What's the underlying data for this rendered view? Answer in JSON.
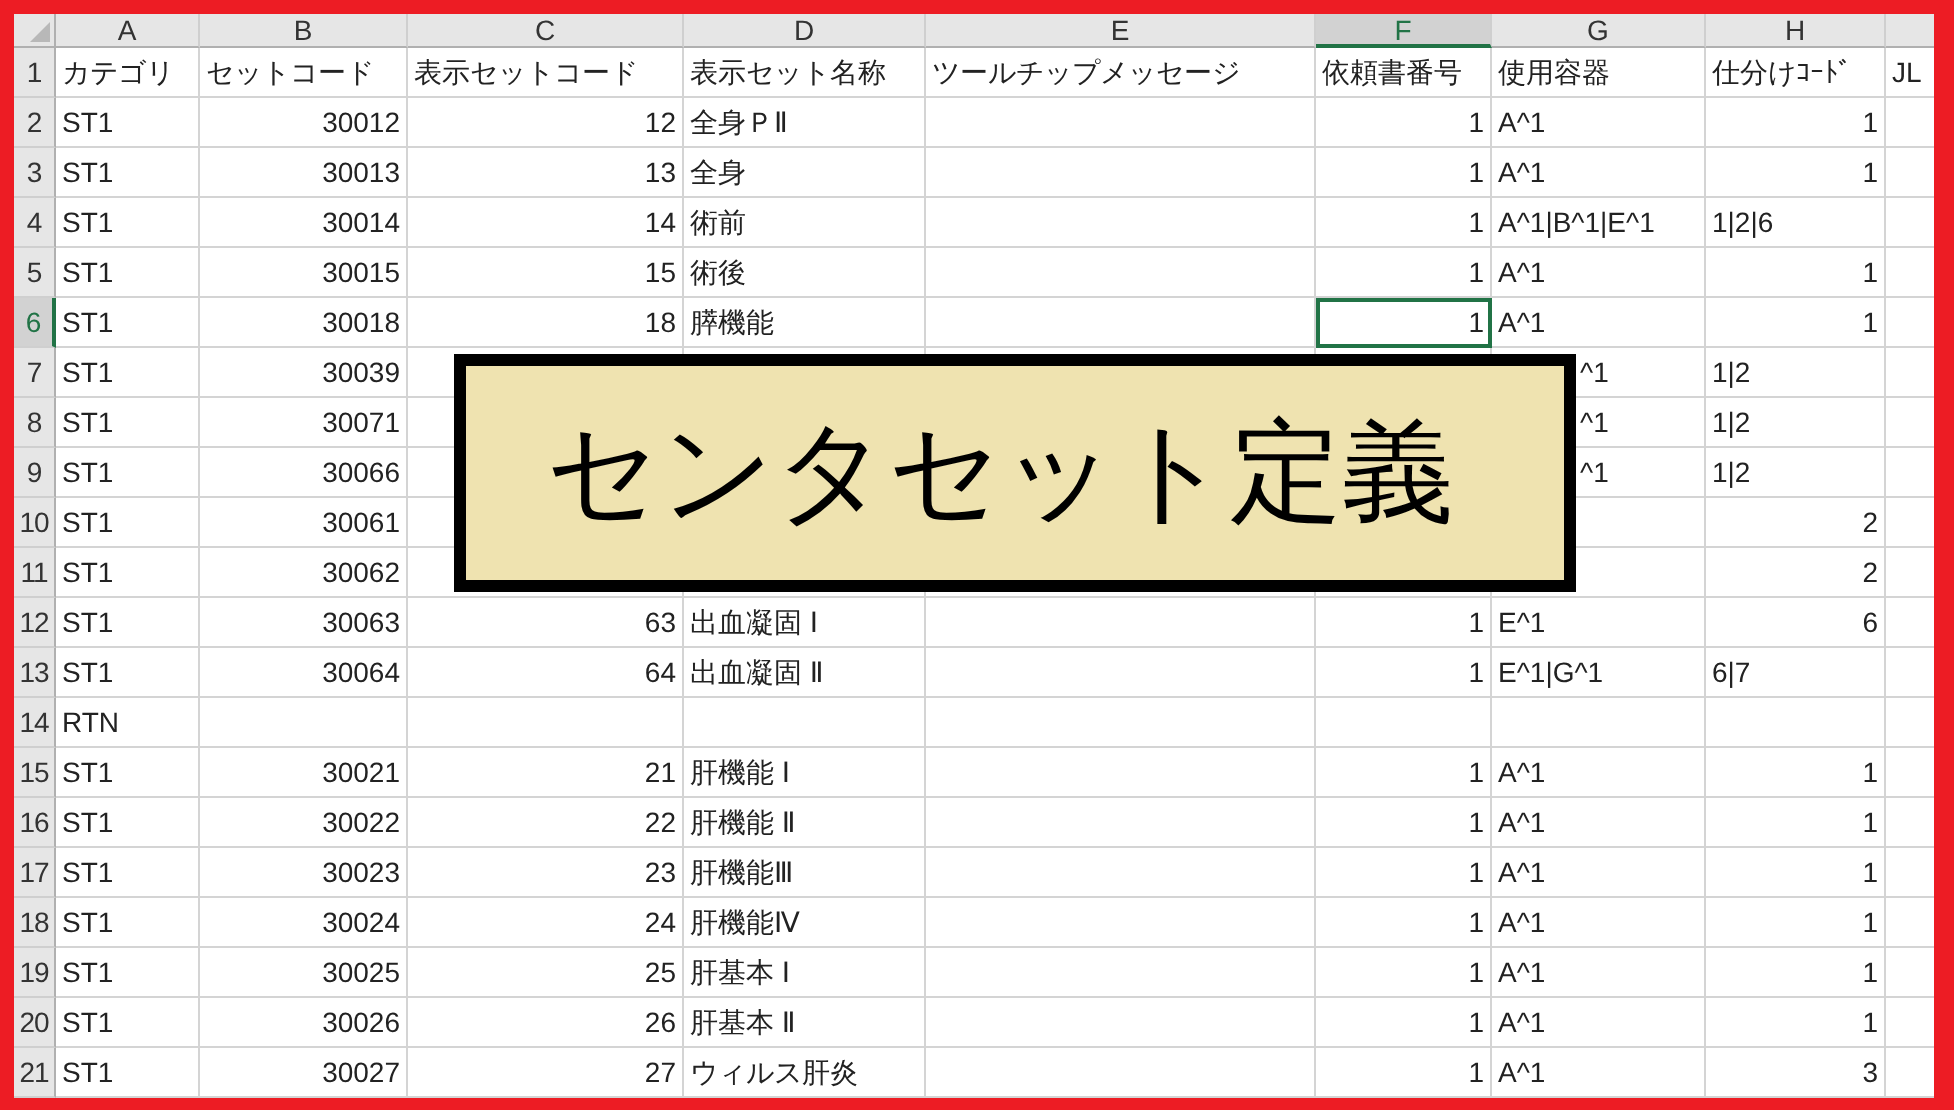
{
  "columns": [
    {
      "letter": "A",
      "selected": false
    },
    {
      "letter": "B",
      "selected": false
    },
    {
      "letter": "C",
      "selected": false
    },
    {
      "letter": "D",
      "selected": false
    },
    {
      "letter": "E",
      "selected": false
    },
    {
      "letter": "F",
      "selected": true
    },
    {
      "letter": "G",
      "selected": false
    },
    {
      "letter": "H",
      "selected": false
    },
    {
      "selected": false
    }
  ],
  "rows": [
    {
      "number": "1",
      "selected": false,
      "covered": false,
      "cells": [
        "カテゴリ",
        "セットコード",
        "表示セットコード",
        "表示セット名称",
        "ツールチップメッセージ",
        "依頼書番号",
        "使用容器",
        "仕分けｺｰﾄﾞ",
        "JL"
      ]
    },
    {
      "number": "2",
      "selected": false,
      "covered": false,
      "cells": [
        "ST1",
        {
          "number": "30012"
        },
        {
          "number": "12"
        },
        "全身ＰⅡ",
        null,
        {
          "number": "1"
        },
        "A^1",
        {
          "number": "1"
        }
      ]
    },
    {
      "number": "3",
      "selected": false,
      "covered": false,
      "cells": [
        "ST1",
        {
          "number": "30013"
        },
        {
          "number": "13"
        },
        "全身",
        null,
        {
          "number": "1"
        },
        "A^1",
        {
          "number": "1"
        }
      ]
    },
    {
      "number": "4",
      "selected": false,
      "covered": false,
      "cells": [
        "ST1",
        {
          "number": "30014"
        },
        {
          "number": "14"
        },
        "術前",
        null,
        {
          "number": "1"
        },
        "A^1|B^1|E^1",
        "1|2|6"
      ]
    },
    {
      "number": "5",
      "selected": false,
      "covered": false,
      "cells": [
        "ST1",
        {
          "number": "30015"
        },
        {
          "number": "15"
        },
        "術後",
        null,
        {
          "number": "1"
        },
        "A^1",
        {
          "number": "1"
        }
      ]
    },
    {
      "number": "6",
      "selected": true,
      "covered": false,
      "cells": [
        "ST1",
        {
          "number": "30018"
        },
        {
          "number": "18"
        },
        "膵機能",
        null,
        {
          "number": "1"
        },
        "A^1",
        {
          "number": "1"
        }
      ]
    },
    {
      "number": "7",
      "selected": false,
      "covered": true,
      "cells": [
        "ST1",
        {
          "number": "30039"
        },
        null,
        null,
        null,
        null,
        "^1",
        "1|2"
      ]
    },
    {
      "number": "8",
      "selected": false,
      "covered": true,
      "cells": [
        "ST1",
        {
          "number": "30071"
        },
        null,
        null,
        null,
        null,
        "^1",
        "1|2"
      ]
    },
    {
      "number": "9",
      "selected": false,
      "covered": true,
      "cells": [
        "ST1",
        {
          "number": "30066"
        },
        null,
        null,
        null,
        null,
        "^1",
        "1|2"
      ]
    },
    {
      "number": "10",
      "selected": false,
      "covered": true,
      "cells": [
        "ST1",
        {
          "number": "30061"
        },
        null,
        null,
        null,
        null,
        null,
        {
          "number": "2"
        }
      ]
    },
    {
      "number": "11",
      "selected": false,
      "covered": true,
      "cells": [
        "ST1",
        {
          "number": "30062"
        },
        null,
        null,
        null,
        null,
        null,
        {
          "number": "2"
        }
      ]
    },
    {
      "number": "12",
      "selected": false,
      "covered": false,
      "cells": [
        "ST1",
        {
          "number": "30063"
        },
        {
          "number": "63"
        },
        "出血凝固 Ⅰ",
        null,
        {
          "number": "1"
        },
        "E^1",
        {
          "number": "6"
        }
      ]
    },
    {
      "number": "13",
      "selected": false,
      "covered": false,
      "cells": [
        "ST1",
        {
          "number": "30064"
        },
        {
          "number": "64"
        },
        "出血凝固 Ⅱ",
        null,
        {
          "number": "1"
        },
        "E^1|G^1",
        "6|7"
      ]
    },
    {
      "number": "14",
      "selected": false,
      "covered": false,
      "cells": [
        "RTN"
      ]
    },
    {
      "number": "15",
      "selected": false,
      "covered": false,
      "cells": [
        "ST1",
        {
          "number": "30021"
        },
        {
          "number": "21"
        },
        "肝機能 Ⅰ",
        null,
        {
          "number": "1"
        },
        "A^1",
        {
          "number": "1"
        }
      ]
    },
    {
      "number": "16",
      "selected": false,
      "covered": false,
      "cells": [
        "ST1",
        {
          "number": "30022"
        },
        {
          "number": "22"
        },
        "肝機能 Ⅱ",
        null,
        {
          "number": "1"
        },
        "A^1",
        {
          "number": "1"
        }
      ]
    },
    {
      "number": "17",
      "selected": false,
      "covered": false,
      "cells": [
        "ST1",
        {
          "number": "30023"
        },
        {
          "number": "23"
        },
        "肝機能Ⅲ",
        null,
        {
          "number": "1"
        },
        "A^1",
        {
          "number": "1"
        }
      ]
    },
    {
      "number": "18",
      "selected": false,
      "covered": false,
      "cells": [
        "ST1",
        {
          "number": "30024"
        },
        {
          "number": "24"
        },
        "肝機能Ⅳ",
        null,
        {
          "number": "1"
        },
        "A^1",
        {
          "number": "1"
        }
      ]
    },
    {
      "number": "19",
      "selected": false,
      "covered": false,
      "cells": [
        "ST1",
        {
          "number": "30025"
        },
        {
          "number": "25"
        },
        "肝基本 Ⅰ",
        null,
        {
          "number": "1"
        },
        "A^1",
        {
          "number": "1"
        }
      ]
    },
    {
      "number": "20",
      "selected": false,
      "covered": false,
      "cells": [
        "ST1",
        {
          "number": "30026"
        },
        {
          "number": "26"
        },
        "肝基本 Ⅱ",
        null,
        {
          "number": "1"
        },
        "A^1",
        {
          "number": "1"
        }
      ]
    },
    {
      "number": "21",
      "selected": false,
      "covered": false,
      "cells": [
        "ST1",
        {
          "number": "30027"
        },
        {
          "number": "27"
        },
        "ウィルス肝炎",
        null,
        {
          "number": "1"
        },
        "A^1",
        {
          "number": "3"
        }
      ]
    }
  ],
  "banner": {
    "title": "センタセット定義"
  }
}
